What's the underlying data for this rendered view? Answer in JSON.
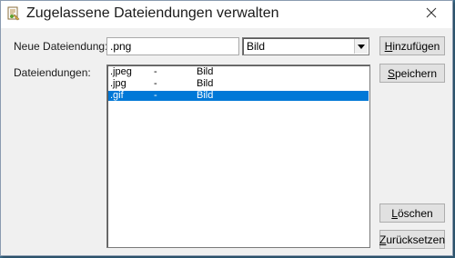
{
  "window": {
    "title": "Zugelassene Dateiendungen verwalten",
    "app_icon": "app-document-icon",
    "close_icon": "close-icon"
  },
  "form": {
    "new_extension_label": "Neue Dateiendung:",
    "new_extension_value": ".png",
    "type_select_value": "Bild",
    "extensions_label": "Dateiendungen:"
  },
  "buttons": {
    "add_prefix": "",
    "add_underline": "H",
    "add_rest": "inzufügen",
    "save_prefix": "",
    "save_underline": "S",
    "save_rest": "peichern",
    "delete_prefix": "",
    "delete_underline": "L",
    "delete_rest": "öschen",
    "reset_prefix": "",
    "reset_underline": "Z",
    "reset_rest": "urücksetzen"
  },
  "extensions_list": [
    {
      "extension": ".jpeg",
      "separator": "-",
      "type": "Bild",
      "selected": false
    },
    {
      "extension": ".jpg",
      "separator": "-",
      "type": "Bild",
      "selected": false
    },
    {
      "extension": ".gif",
      "separator": "-",
      "type": "Bild",
      "selected": true
    }
  ],
  "colors": {
    "selection": "#0078d7",
    "dialog_bg": "#f0f0f0"
  }
}
